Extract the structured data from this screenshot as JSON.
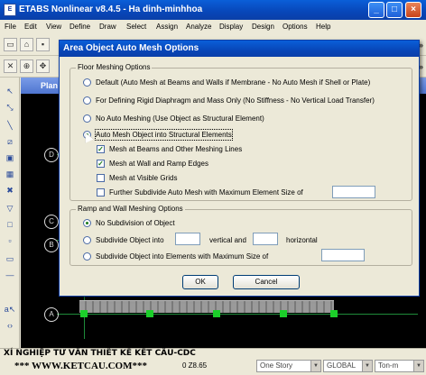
{
  "window": {
    "title": "ETABS Nonlinear v8.4.5 - Ha dinh-minhhoa",
    "app_icon_text": "ETABS",
    "buttons": [
      "_",
      "□",
      "×"
    ]
  },
  "menu": [
    "File",
    "Edit",
    "View",
    "Define",
    "Draw",
    "Select",
    "Assign",
    "Analyze",
    "Display",
    "Design",
    "Options",
    "Help"
  ],
  "plan_window_title": "Plan",
  "grid_bubbles": [
    "D",
    "C",
    "B",
    "A"
  ],
  "dialog": {
    "title": "Area Object Auto Mesh Options",
    "floor_group_label": "Floor Meshing Options",
    "floor_options": [
      {
        "label": "Default  (Auto Mesh at Beams and Walls if Membrane - No Auto Mesh if Shell or Plate)",
        "selected": false
      },
      {
        "label": "For Defining Rigid Diaphragm and Mass Only  (No Stiffness - No Vertical Load Transfer)",
        "selected": false
      },
      {
        "label": "No Auto Meshing  (Use Object as Structural Element)",
        "selected": false
      },
      {
        "label": "Auto Mesh Object into Structural Elements",
        "selected": true
      }
    ],
    "mesh_checks": [
      {
        "label": "Mesh at Beams and Other Meshing Lines",
        "checked": true
      },
      {
        "label": "Mesh at Wall and Ramp Edges",
        "checked": true
      },
      {
        "label": "Mesh at Visible Grids",
        "checked": false
      },
      {
        "label": "Further Subdivide Auto Mesh with Maximum Element Size of",
        "checked": false
      }
    ],
    "max_element_size_value": "",
    "ramp_group_label": "Ramp and Wall Meshing Options",
    "ramp_options": [
      {
        "label": "No Subdivision of Object",
        "selected": true
      },
      {
        "label": "Subdivide Object into",
        "selected": false
      },
      {
        "label": "Subdivide Object into Elements with Maximum Size of",
        "selected": false
      }
    ],
    "vertical_label": "vertical  and",
    "horizontal_label": "horizontal",
    "vertical_value": "",
    "horizontal_value": "",
    "ramp_max_size_value": "",
    "ok_label": "OK",
    "cancel_label": "Cancel"
  },
  "status": {
    "banner_line1": "XÍ NGHIỆP TƯ VẤN THIẾT KẾ KẾT CẤU-CDC",
    "banner_line2": "*** WWW.KETCAU.COM***",
    "z_readout": "0  Z8.65",
    "story_dropdown": "One Story",
    "coord_dropdown": "GLOBAL",
    "units_dropdown": "Ton-m"
  }
}
